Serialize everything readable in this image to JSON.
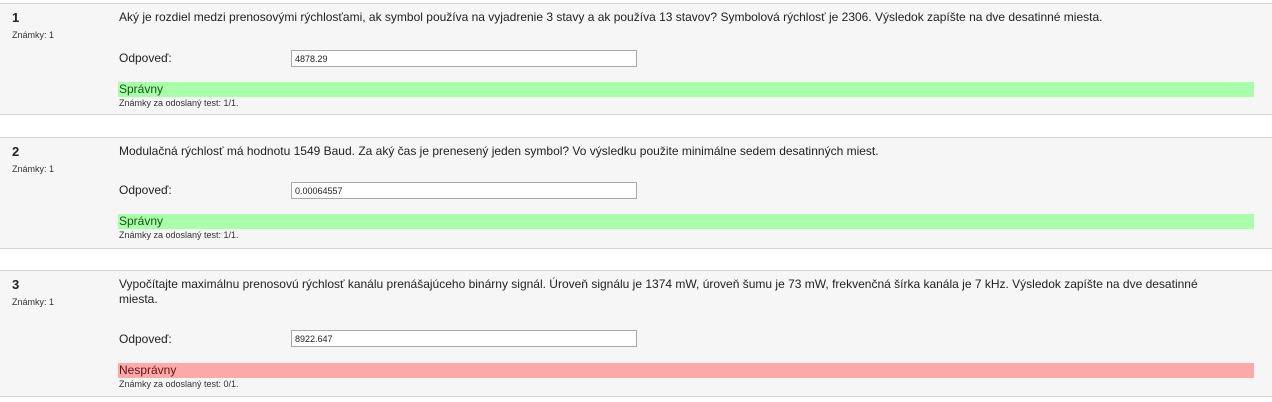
{
  "questions": [
    {
      "number": "1",
      "grade": "Známky: 1",
      "text": "Aký je rozdiel medzi prenosovými rýchlosťami, ak symbol používa na vyjadrenie 3 stavy a ak používa 13 stavov? Symbolová rýchlosť je 2306. Výsledok zapíšte na dve desatinné miesta.",
      "answer_label": "Odpoveď:",
      "answer_value": "4878.29",
      "result": "Správny",
      "result_status": "correct",
      "submitted_grade": "Známky za odoslaný test: 1/1."
    },
    {
      "number": "2",
      "grade": "Známky: 1",
      "text": "Modulačná rýchlosť má hodnotu 1549 Baud. Za aký čas je prenesený jeden symbol? Vo výsledku použite minimálne sedem desatinných miest.",
      "answer_label": "Odpoveď:",
      "answer_value": "0.00064557",
      "result": "Správny",
      "result_status": "correct",
      "submitted_grade": "Známky za odoslaný test: 1/1."
    },
    {
      "number": "3",
      "grade": "Známky: 1",
      "text": "Vypočítajte maximálnu prenosovú rýchlosť kanálu prenášajúceho binárny signál. Úroveň signálu je 1374 mW, úroveň šumu je 73 mW, frekvenčná šírka kanála je 7 kHz. Výsledok zapíšte na dve desatinné miesta.",
      "answer_label": "Odpoveď:",
      "answer_value": "8922.647",
      "result": "Nesprávny",
      "result_status": "incorrect",
      "submitted_grade": "Známky za odoslaný test: 0/1."
    }
  ],
  "colors": {
    "correct_bg": "#aaffaa",
    "incorrect_bg": "#ffaaaa",
    "question_bg": "#f6f6f6"
  }
}
